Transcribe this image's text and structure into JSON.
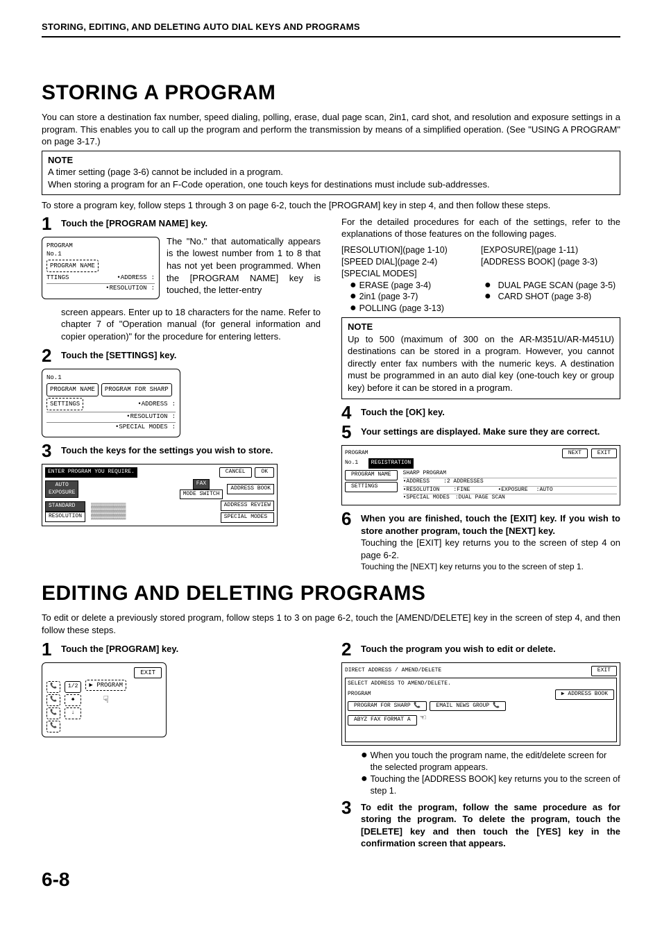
{
  "header": "STORING, EDITING, AND DELETING AUTO DIAL KEYS AND PROGRAMS",
  "h1a": "STORING A PROGRAM",
  "intro1": "You can store a destination fax number, speed dialing, polling, erase, dual page scan, 2in1, card shot, and resolution and exposure settings in a program. This enables you to call up the program and perform the transmission by means of a simplified operation. (See \"USING A PROGRAM\" on page 3-17.)",
  "note1_title": "NOTE",
  "note1_l1": "A timer setting (page 3-6) cannot be included in a program.",
  "note1_l2": "When storing a program for an F-Code operation, one touch keys for destinations must include sub-addresses.",
  "pre_steps": "To store a program key, follow steps 1 through 3 on  page 6-2, touch the [PROGRAM] key in step 4, and then follow these steps.",
  "s1_title": "Touch the [PROGRAM NAME] key.",
  "scr1": {
    "title": "PROGRAM",
    "no": "No.1",
    "pn": "PROGRAM NAME",
    "settings": "TTINGS",
    "addr": "•ADDRESS",
    "res": "•RESOLUTION"
  },
  "s1_body1": "The \"No.\" that automatically appears is the lowest number from 1 to 8 that has not yet been programmed. When the [PROGRAM NAME] key is touched, the letter-entry",
  "s1_body2": "screen appears. Enter up to 18 characters for the name. Refer to chapter 7 of \"Operation manual (for general information and copier operation)\" for the procedure for entering letters.",
  "s2_title": "Touch the [SETTINGS] key.",
  "scr2": {
    "no": "No.1",
    "pn": "PROGRAM NAME",
    "pfs": "PROGRAM FOR SHARP",
    "settings": "SETTINGS",
    "addr": "•ADDRESS",
    "res": "•RESOLUTION",
    "sm": "•SPECIAL MODES"
  },
  "s3_title": "Touch the keys for the settings you wish to store.",
  "scr3": {
    "header": "ENTER PROGRAM YOU REQUIRE.",
    "cancel": "CANCEL",
    "ok": "OK",
    "ae": "AUTO\nEXPOSURE",
    "fax": "FAX",
    "ms": "MODE SWITCH",
    "ab": "ADDRESS BOOK",
    "std": "STANDARD",
    "res": "RESOLUTION",
    "ar": "ADDRESS REVIEW",
    "sm": "SPECIAL MODES"
  },
  "right_intro": "For the detailed procedures for each of the settings, refer to the explanations of those features on the following pages.",
  "refs": {
    "r1a": "[RESOLUTION](page 1-10)",
    "r1b": "[EXPOSURE](page 1-11)",
    "r2a": "[SPEED DIAL](page 2-4)",
    "r2b": "[ADDRESS BOOK] (page 3-3)",
    "r3": "[SPECIAL MODES]",
    "b1a": "ERASE (page 3-4)",
    "b1b": "DUAL PAGE SCAN (page 3-5)",
    "b2a": "2in1 (page 3-7)",
    "b2b": "CARD SHOT (page 3-8)",
    "b3": "POLLING (page 3-13)"
  },
  "note2_title": "NOTE",
  "note2_body": "Up to 500 (maximum of 300 on the AR-M351U/AR-M451U) destinations can be stored in a program. However, you cannot directly enter fax numbers with the numeric keys. A destination must be programmed in an auto dial key (one-touch key or group key) before it can be stored in a program.",
  "s4_title": "Touch the [OK] key.",
  "s5_title": "Your settings are displayed. Make sure they are correct.",
  "scr5": {
    "prog": "PROGRAM",
    "next": "NEXT",
    "exit": "EXIT",
    "no": "No.1",
    "reg": "REGISTRATION",
    "pn": "PROGRAM NAME",
    "sp": "SHARP PROGRAM",
    "settings": "SETTINGS",
    "addr": "•ADDRESS",
    "addrv": ":2 ADDRESSES",
    "res": "•RESOLUTION",
    "resv": ":FINE",
    "exp": "•EXPOSURE",
    "expv": ":AUTO",
    "sm": "•SPECIAL MODES",
    "smv": ":DUAL PAGE SCAN"
  },
  "s6_title": "When you are finished, touch the [EXIT] key. If you wish to store another program, touch the [NEXT] key.",
  "s6_b1": "Touching the [EXIT] key returns you to the screen of step 4 on page 6-2.",
  "s6_b2": "Touching the [NEXT] key returns you to the screen of step 1.",
  "h1b": "EDITING AND DELETING PROGRAMS",
  "intro2": "To edit or delete a previously stored program, follow steps 1 to 3 on page 6-2, touch the [AMEND/DELETE] key in the screen of step 4, and then follow these steps.",
  "e1_title": "Touch the [PROGRAM] key.",
  "scrE1": {
    "exit": "EXIT",
    "half": "1/2",
    "prog": "PROGRAM"
  },
  "e2_title": "Touch the program you wish to edit or delete.",
  "scrE2": {
    "h1": "DIRECT ADDRESS / AMEND/DELETE",
    "exit": "EXIT",
    "h2": "SELECT ADDRESS TO AMEND/DELETE.",
    "prog": "PROGRAM",
    "ab": "ADDRESS BOOK",
    "p1": "PROGRAM FOR SHARP",
    "p2": "EMAIL NEWS GROUP",
    "p3": "ABYZ FAX FORMAT A"
  },
  "e2_b1": "When you touch the program name, the edit/delete screen for the selected program appears.",
  "e2_b2": "Touching the [ADDRESS BOOK] key returns you to the screen of step 1.",
  "e3_title": "To edit the program, follow the same procedure as for storing the program. To delete the program, touch the [DELETE] key and then touch the [YES] key in the confirmation screen that appears.",
  "page_num": "6-8"
}
